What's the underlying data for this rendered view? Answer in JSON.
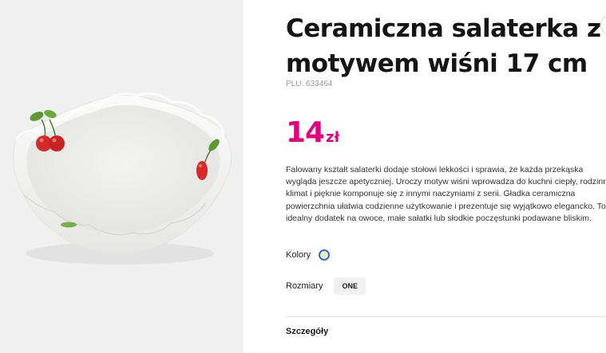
{
  "product": {
    "title": "Ceramiczna salaterka z motywem wiśni 17 cm",
    "plu_label": "PLU:",
    "plu_value": "633464",
    "price_amount": "14",
    "price_currency": "zł",
    "description": "Falowany kształt salaterki dodaje stołowi lekkości i sprawia, że każda przekąska wygląda jeszcze apetyczniej. Uroczy motyw wiśni wprowadza do kuchni ciepły, rodzinny klimat i pięknie komponuje się z innymi naczyniami z serii. Gładka ceramiczna powierzchnia ułatwia codzienne użytkowanie i prezentuje się wyjątkowo elegancko. To idealny dodatek na owoce, małe sałatki lub słodkie poczęstunki podawane bliskim."
  },
  "options": {
    "colors_label": "Kolory",
    "selected_color": "#f4efb6",
    "sizes_label": "Rozmiary",
    "size_value": "ONE"
  },
  "details": {
    "label": "Szczegóły"
  },
  "theme": {
    "price_color": "#e6007e",
    "swatch_ring": "#2d6cdf"
  }
}
